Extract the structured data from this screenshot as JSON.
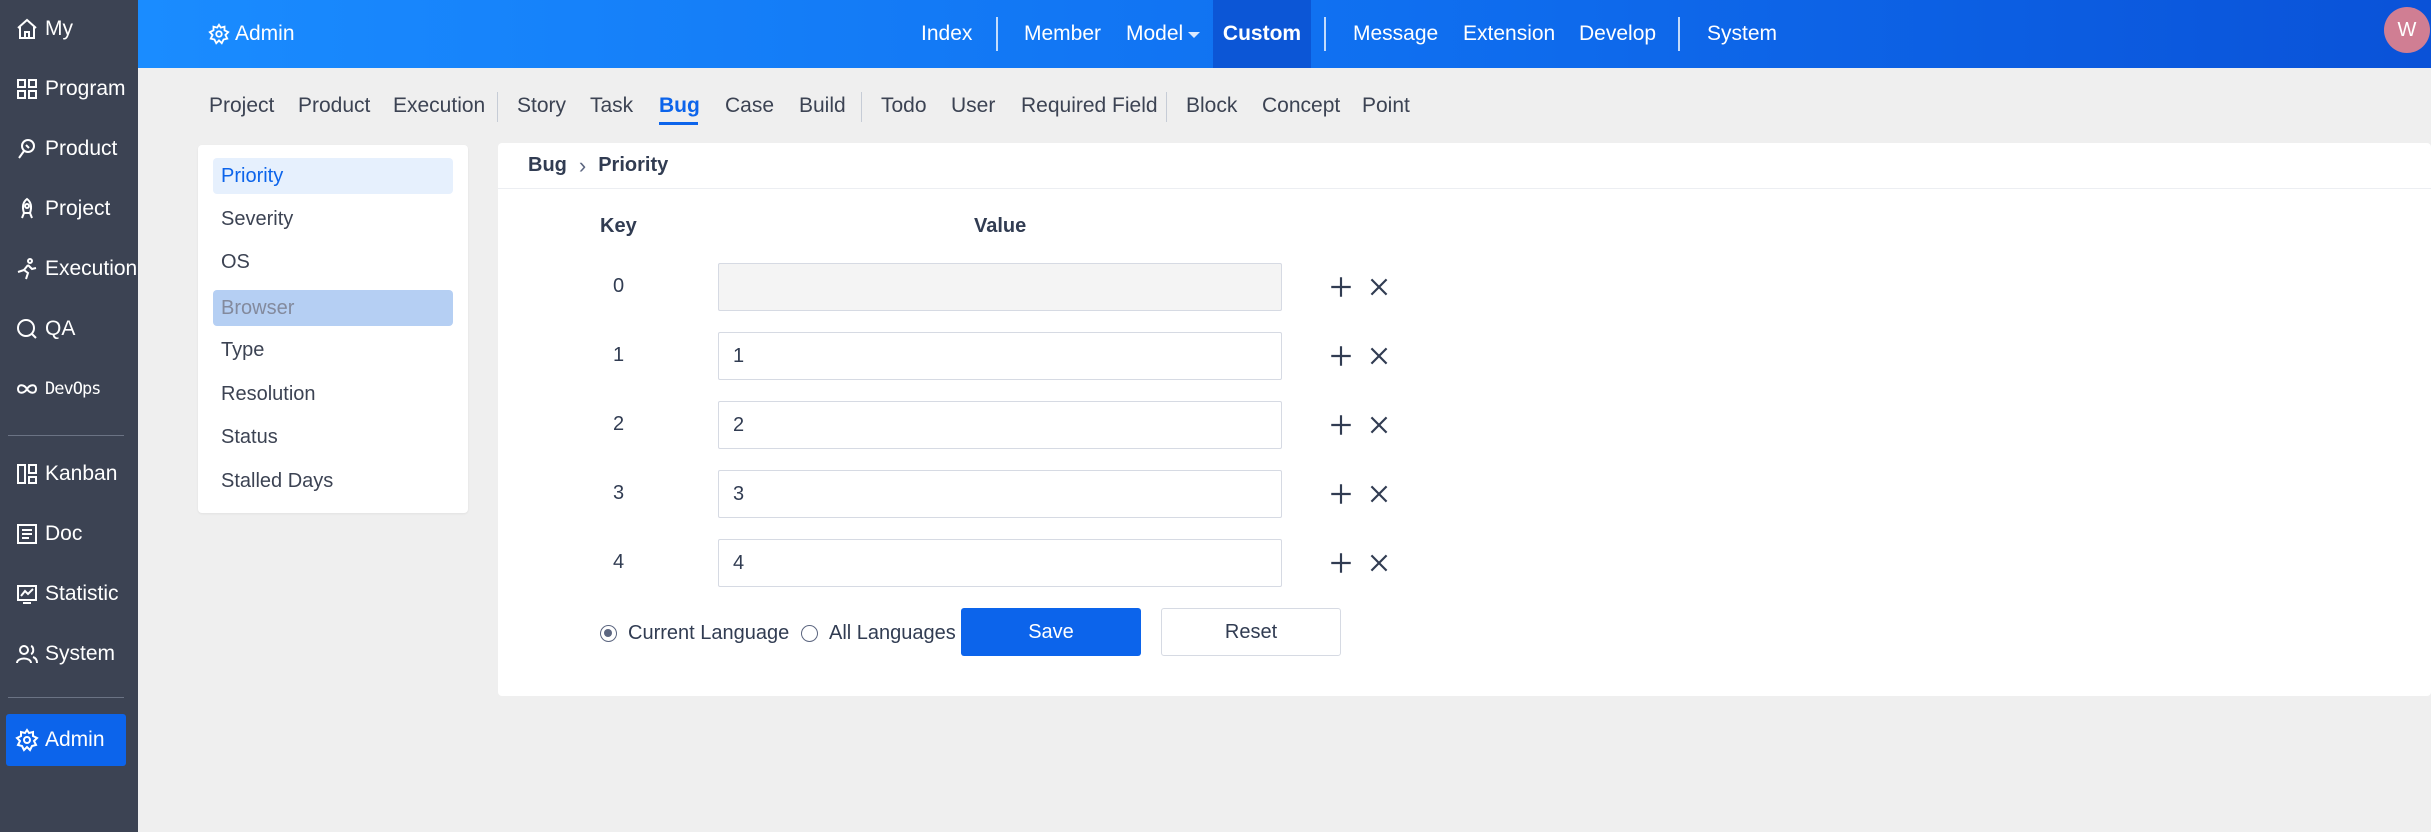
{
  "sidebar": {
    "items": [
      {
        "label": "My",
        "icon": "home-icon"
      },
      {
        "label": "Program",
        "icon": "grid-icon"
      },
      {
        "label": "Product",
        "icon": "bulb-icon"
      },
      {
        "label": "Project",
        "icon": "rocket-icon"
      },
      {
        "label": "Execution",
        "icon": "run-icon"
      },
      {
        "label": "QA",
        "icon": "search-icon"
      },
      {
        "label": "DevOps",
        "icon": "infinity-icon"
      },
      {
        "label": "Kanban",
        "icon": "kanban-icon"
      },
      {
        "label": "Doc",
        "icon": "doc-icon"
      },
      {
        "label": "Statistic",
        "icon": "chart-icon"
      },
      {
        "label": "System",
        "icon": "users-icon"
      },
      {
        "label": "Admin",
        "icon": "gear-icon"
      }
    ]
  },
  "topbar": {
    "title": "Admin",
    "nav": [
      "Index",
      "Member",
      "Model",
      "Custom",
      "Message",
      "Extension",
      "Develop",
      "System"
    ],
    "active": "Custom",
    "avatar": "W"
  },
  "subnav": {
    "items": [
      "Project",
      "Product",
      "Execution",
      "Story",
      "Task",
      "Bug",
      "Case",
      "Build",
      "Todo",
      "User",
      "Required Field",
      "Block",
      "Concept",
      "Point"
    ],
    "active": "Bug"
  },
  "menu": {
    "items": [
      "Priority",
      "Severity",
      "OS",
      "Browser",
      "Type",
      "Resolution",
      "Status",
      "Stalled Days"
    ],
    "active": "Priority",
    "hover": "Browser"
  },
  "breadcrumb": {
    "parent": "Bug",
    "current": "Priority"
  },
  "table": {
    "key_header": "Key",
    "value_header": "Value",
    "rows": [
      {
        "key": "0",
        "value": ""
      },
      {
        "key": "1",
        "value": "1"
      },
      {
        "key": "2",
        "value": "2"
      },
      {
        "key": "3",
        "value": "3"
      },
      {
        "key": "4",
        "value": "4"
      }
    ]
  },
  "form": {
    "lang_current": "Current Language",
    "lang_all": "All Languages",
    "selected_lang": "Current Language",
    "save_label": "Save",
    "reset_label": "Reset"
  },
  "colors": {
    "primary": "#0c64eb",
    "sidebar": "#3c4353",
    "avatar": "#d07e93"
  }
}
